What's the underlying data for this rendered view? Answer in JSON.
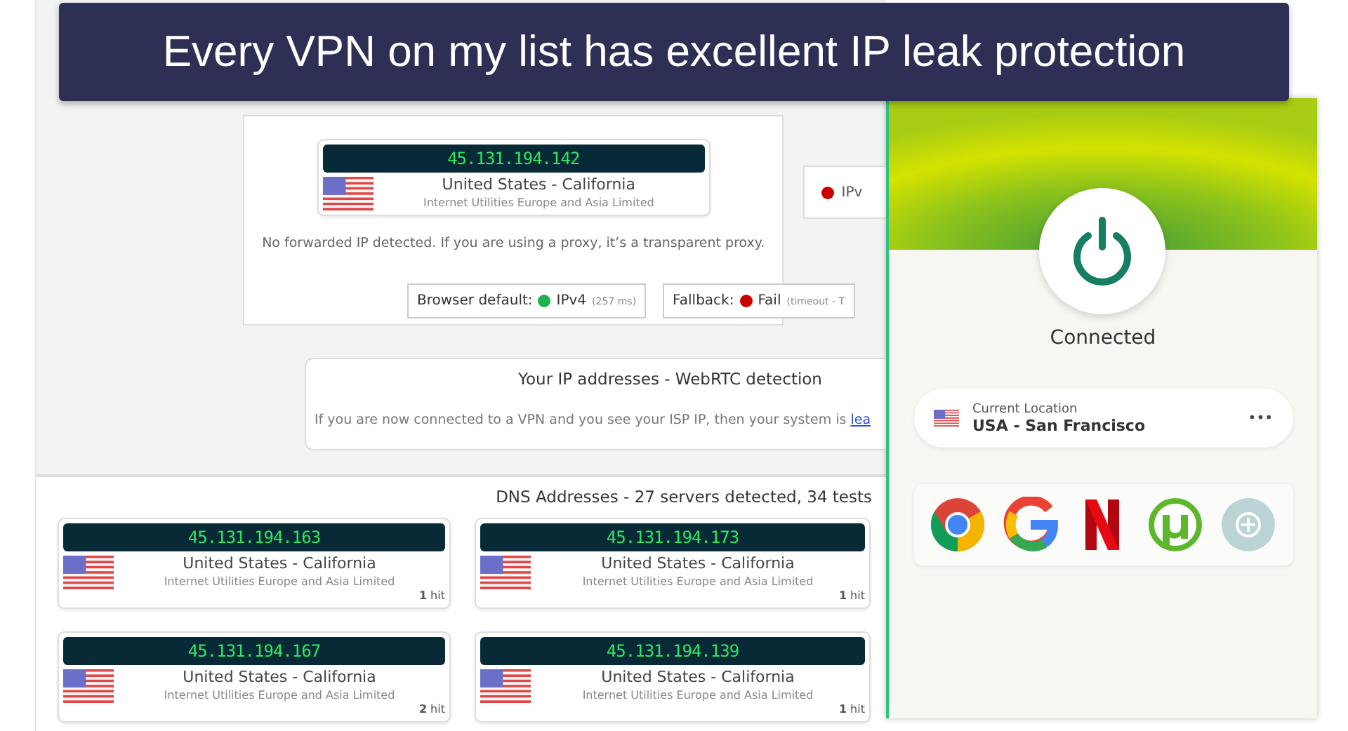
{
  "caption": "Every VPN on my list has excellent IP leak protection",
  "ip_card": {
    "ip": "45.131.194.142",
    "location": "United States - California",
    "isp": "Internet Utilities Europe and Asia Limited",
    "note": "No forwarded IP detected. If you are using a proxy, it’s a transparent proxy."
  },
  "side_status": {
    "label": "IPv",
    "color": "#cc0000"
  },
  "checks": [
    {
      "label": "Browser default:",
      "value": "IPv4",
      "detail": "(257 ms)",
      "color": "#22b14c"
    },
    {
      "label": "Fallback:",
      "value": "Fail",
      "detail": "(timeout - T",
      "color": "#cc0000"
    }
  ],
  "webrtc": {
    "title": "Your IP addresses - WebRTC detection",
    "text": "If you are now connected to a VPN and you see your ISP IP, then your system is",
    "link": "lea"
  },
  "dns": {
    "title": "DNS Addresses - 27 servers detected, 34 tests",
    "servers": [
      {
        "ip": "45.131.194.163",
        "location": "United States - California",
        "isp": "Internet Utilities Europe and Asia Limited",
        "hits": "1",
        "hit_label": "hit"
      },
      {
        "ip": "45.131.194.173",
        "location": "United States - California",
        "isp": "Internet Utilities Europe and Asia Limited",
        "hits": "1",
        "hit_label": "hit"
      },
      {
        "ip": "45.131.194.167",
        "location": "United States - California",
        "isp": "Internet Utilities Europe and Asia Limited",
        "hits": "2",
        "hit_label": "hit"
      },
      {
        "ip": "45.131.194.139",
        "location": "United States - California",
        "isp": "Internet Utilities Europe and Asia Limited",
        "hits": "1",
        "hit_label": "hit"
      }
    ]
  },
  "vpn": {
    "status": "Connected",
    "location_label": "Current Location",
    "location": "USA - San Francisco",
    "more": "•••",
    "shortcuts": [
      {
        "kind": "chrome"
      },
      {
        "kind": "google"
      },
      {
        "kind": "netflix"
      },
      {
        "kind": "utorrent"
      },
      {
        "kind": "add"
      }
    ]
  }
}
